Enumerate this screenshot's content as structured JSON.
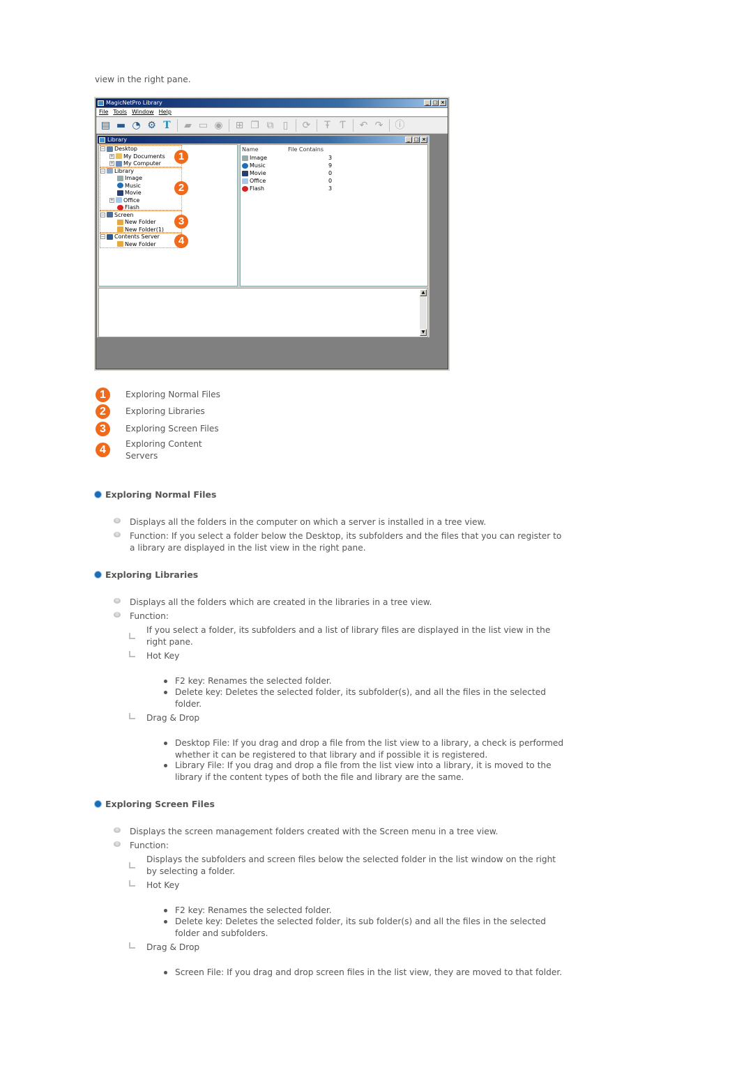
{
  "intro_text": "view in the right pane.",
  "app": {
    "title": "MagicNetPro Library",
    "window_buttons": [
      "_",
      "□",
      "×"
    ],
    "menu": [
      "File",
      "Tools",
      "Window",
      "Help"
    ],
    "toolbar_icons": [
      "library-icon",
      "screen-icon",
      "schedule-icon",
      "settings-icon",
      "text-icon",
      "open-folder-icon",
      "save-icon",
      "preview-icon",
      "add-icon",
      "copy-icon",
      "paste-icon",
      "delete-icon",
      "refresh-icon",
      "text-in-icon",
      "text-out-icon",
      "undo-icon",
      "redo-icon",
      "info-icon"
    ],
    "child_window": {
      "title": "Library",
      "tree": [
        {
          "label": "Desktop",
          "level": 0,
          "expander": "−"
        },
        {
          "label": "My Documents",
          "level": 1,
          "expander": "+"
        },
        {
          "label": "My Computer",
          "level": 1,
          "expander": "+"
        },
        {
          "label": "Library",
          "level": 0,
          "expander": "−"
        },
        {
          "label": "Image",
          "level": 1,
          "expander": ""
        },
        {
          "label": "Music",
          "level": 1,
          "expander": ""
        },
        {
          "label": "Movie",
          "level": 1,
          "expander": ""
        },
        {
          "label": "Office",
          "level": 1,
          "expander": "+"
        },
        {
          "label": "Flash",
          "level": 1,
          "expander": ""
        },
        {
          "label": "Screen",
          "level": 0,
          "expander": "−"
        },
        {
          "label": "New Folder",
          "level": 1,
          "expander": ""
        },
        {
          "label": "New Folder(1)",
          "level": 1,
          "expander": ""
        },
        {
          "label": "Contents Server",
          "level": 0,
          "expander": "−"
        },
        {
          "label": "New Folder",
          "level": 1,
          "expander": ""
        }
      ],
      "callouts": [
        "1",
        "2",
        "3",
        "4"
      ],
      "list_headers": [
        "Name",
        "File Contains"
      ],
      "list_rows": [
        {
          "name": "Image",
          "count": "3"
        },
        {
          "name": "Music",
          "count": "9"
        },
        {
          "name": "Movie",
          "count": "0"
        },
        {
          "name": "Office",
          "count": "0"
        },
        {
          "name": "Flash",
          "count": "3"
        }
      ]
    }
  },
  "legend": [
    {
      "num": "1",
      "label": "Exploring Normal Files"
    },
    {
      "num": "2",
      "label": "Exploring Libraries"
    },
    {
      "num": "3",
      "label": "Exploring Screen Files"
    },
    {
      "num": "4",
      "label": "Exploring Content Servers"
    }
  ],
  "sections": {
    "normal": {
      "title": "Exploring Normal Files",
      "bullets": [
        "Displays all the folders in the computer on which a server is installed in a tree view.",
        "Function: If you select a folder below the Desktop, its subfolders and the files that you can register to a library are displayed in the list view in the right pane."
      ]
    },
    "libraries": {
      "title": "Exploring Libraries",
      "bullets": [
        "Displays all the folders which are created in the libraries in a tree view.",
        "Function:"
      ],
      "function_desc": "If you select a folder, its subfolders and a list of library files are displayed in the list view in the right pane.",
      "hotkey_label": "Hot Key",
      "hotkeys": [
        "F2 key: Renames the selected folder.",
        "Delete key: Deletes the selected folder, its subfolder(s), and all the files in the selected folder."
      ],
      "dragdrop_label": "Drag & Drop",
      "dragdrop": [
        "Desktop File: If you drag and drop a file from the list view to a library, a check is performed whether it can be registered to that library and if possible it is registered.",
        "Library File: If you drag and drop a file from the list view into a library, it is moved to the library if the content types of both the file and library are the same."
      ]
    },
    "screen": {
      "title": "Exploring Screen Files",
      "bullets": [
        "Displays the screen management folders created with the Screen menu in a tree view.",
        "Function:"
      ],
      "function_desc": "Displays the subfolders and screen files below the selected folder in the list window on the right by selecting a folder.",
      "hotkey_label": "Hot Key",
      "hotkeys": [
        "F2 key: Renames the selected folder.",
        "Delete key: Deletes the selected folder, its sub folder(s) and all the files in the selected folder and subfolders."
      ],
      "dragdrop_label": "Drag & Drop",
      "dragdrop": [
        "Screen File: If you drag and drop screen files in the list view, they are moved to that folder."
      ]
    }
  },
  "colors": {
    "callout_orange": "#f06a1c",
    "heading_bullet_blue": "#1c6db8",
    "titlebar_blue": "#0a246a",
    "text_gray": "#555555"
  }
}
